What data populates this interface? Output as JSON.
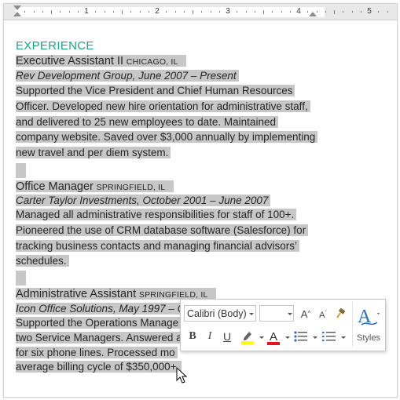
{
  "ruler": {
    "numbers": [
      "1",
      "2",
      "3",
      "4",
      "5"
    ]
  },
  "document": {
    "section_heading": "EXPERIENCE",
    "jobs": [
      {
        "title": "Executive Assistant II",
        "location": "CHICAGO, IL",
        "company_line": "Rev Development Group, June 2007 – Present",
        "description_lines": [
          "Supported the Vice President and Chief Human Resources",
          "Officer. Developed new hire orientation for administrative staff,",
          "and delivered to 25 new employees to date. Maintained",
          "company website. Saved over $3,000 annually by implementing",
          "new travel and per diem system."
        ]
      },
      {
        "title": "Office Manager",
        "location": "SPRINGFIELD, IL",
        "company_line": "Carter Taylor Investments, October 2001 – June 2007",
        "description_lines": [
          "Managed all administrative responsibilities for staff of 100+.",
          "Pioneered the use of CRM database software (Salesforce) for",
          "tracking business contacts and managing financial advisors’",
          "schedules."
        ]
      },
      {
        "title": "Administrative Assistant",
        "location": "SPRINGFIELD, IL",
        "company_line": "Icon Office Solutions, May 1997 – C",
        "description_lines": [
          "Supported the Operations Manage",
          "two Service Managers. Answered a",
          "for six phone lines. Processed mo",
          "average billing cycle of $350,000+."
        ]
      }
    ]
  },
  "mini_toolbar": {
    "font_name": "Calibri (Body)",
    "font_size": "",
    "grow_font": "A",
    "shrink_font": "A",
    "bold": "B",
    "italic": "I",
    "underline": "U",
    "font_color_letter": "A",
    "styles_label": "Styles",
    "highlight_color": "#ffff00",
    "font_color": "#e81123"
  }
}
